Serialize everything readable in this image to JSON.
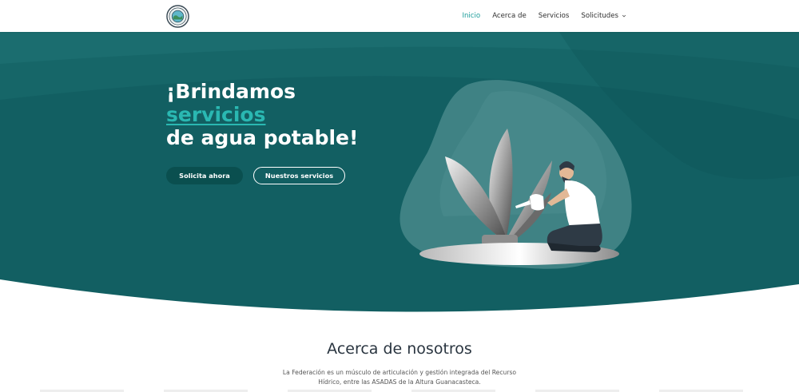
{
  "nav": {
    "items": [
      {
        "label": "Inicio",
        "active": true
      },
      {
        "label": "Acerca de",
        "active": false
      },
      {
        "label": "Servicios",
        "active": false
      },
      {
        "label": "Solicitudes",
        "active": false,
        "dropdown": true
      }
    ]
  },
  "hero": {
    "headline_line1": "¡Brindamos",
    "headline_accent": "servicios",
    "headline_line3": "de agua potable!",
    "primary_button": "Solicita ahora",
    "secondary_button": "Nuestros servicios"
  },
  "about": {
    "title": "Acerca de nosotros",
    "text": "La Federación es un músculo de articulación y gestión integrada del Recurso Hídrico, entre las ASADAS de la Altura Guanacasteca."
  },
  "colors": {
    "hero_bg": "#125f62",
    "accent": "#2ab8b2",
    "nav_active": "#1a9c9a",
    "primary_button": "#0a4f4f"
  },
  "icons": {
    "logo": "federation-seal-logo",
    "dropdown": "chevron-down-icon"
  }
}
